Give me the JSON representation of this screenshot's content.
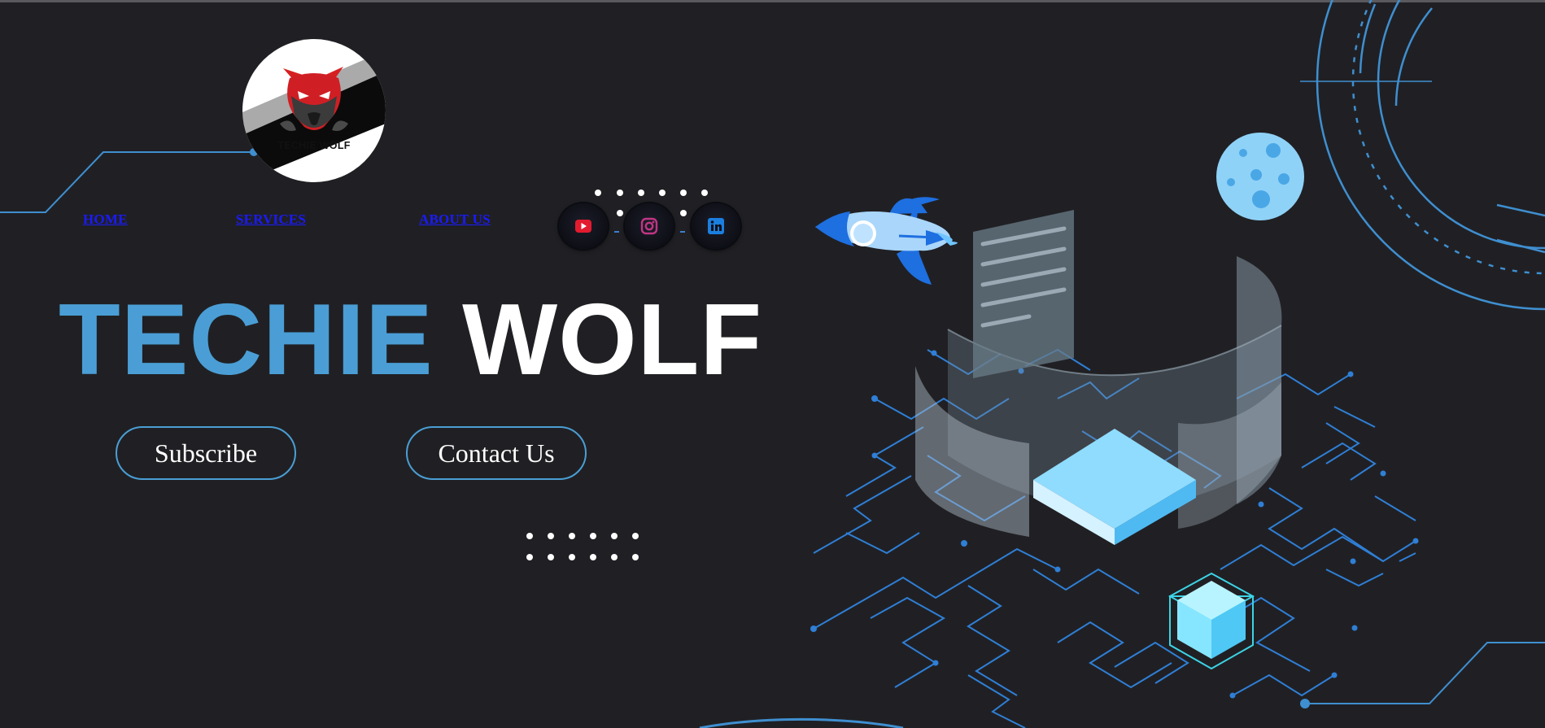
{
  "brand": {
    "logo_text": "TECHIE WOLF"
  },
  "nav": {
    "items": [
      {
        "label": "HOME"
      },
      {
        "label": "SERVICES"
      },
      {
        "label": "ABOUT US"
      }
    ]
  },
  "social": [
    {
      "name": "youtube-icon",
      "color": "#e31b2f"
    },
    {
      "name": "instagram-icon",
      "color": "#c13584"
    },
    {
      "name": "linkedin-icon",
      "color": "#1b7fe0"
    }
  ],
  "hero": {
    "title_part1": "TECHIE",
    "title_part2": "WOLF",
    "subscribe_label": "Subscribe",
    "contact_label": "Contact Us"
  },
  "colors": {
    "background": "#202024",
    "accent": "#4a9ed5",
    "nav_link": "#1a1aff"
  }
}
